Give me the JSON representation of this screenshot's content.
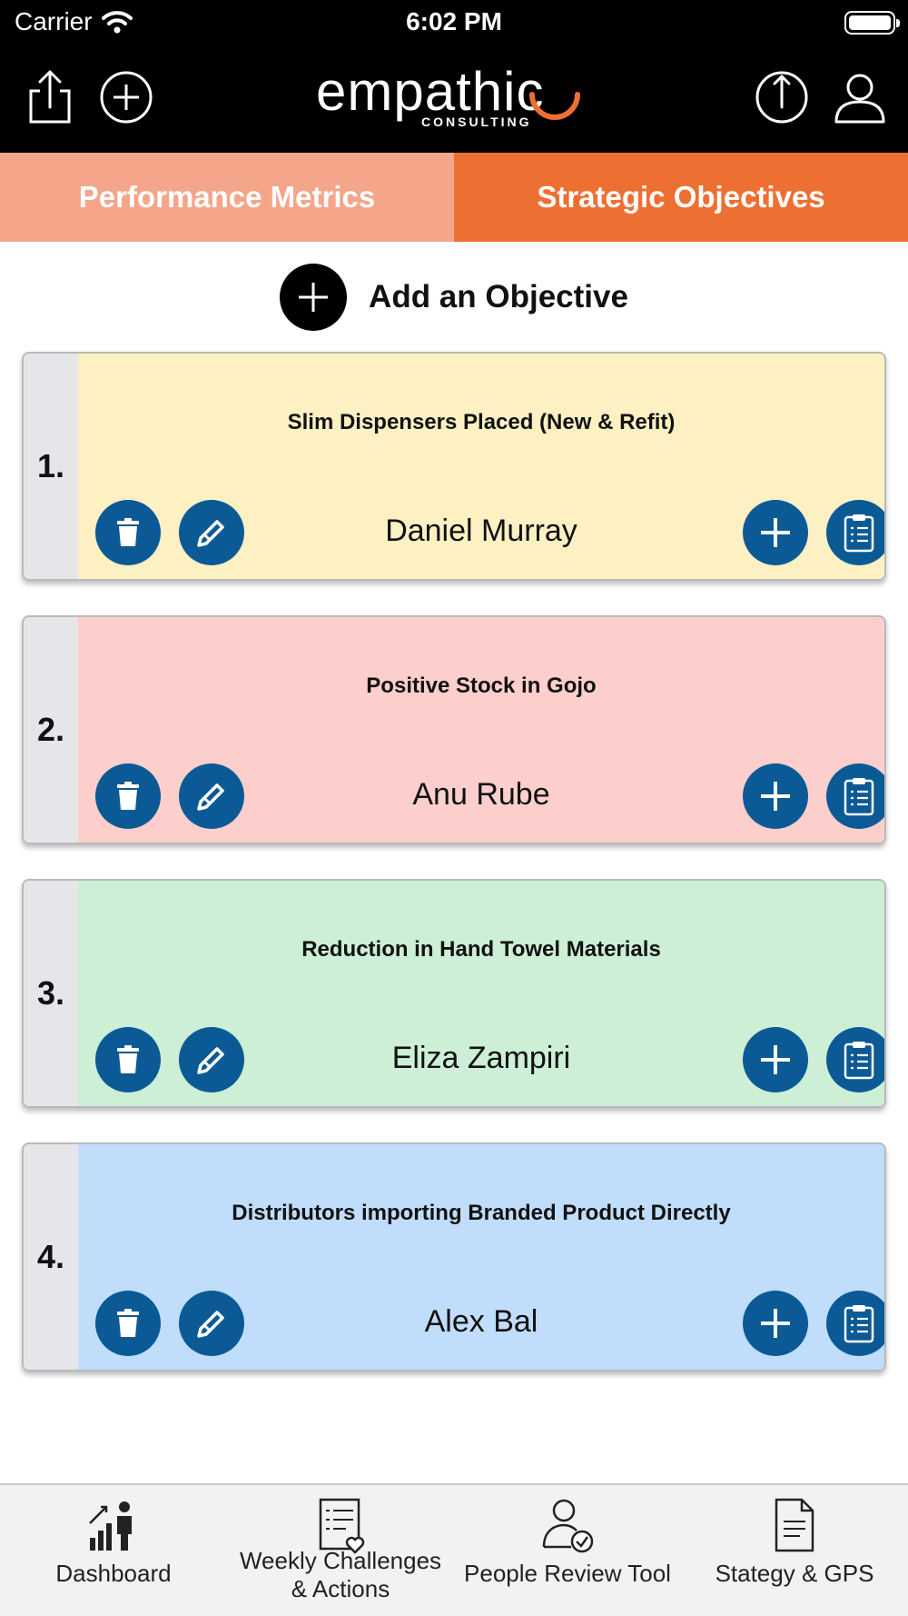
{
  "status_bar": {
    "carrier": "Carrier",
    "time": "6:02 PM"
  },
  "header": {
    "brand": "empathic",
    "brand_sub": "CONSULTING",
    "brand_accent": "#ee6f32",
    "icons": [
      "share-icon",
      "plus-circle-icon",
      "upload-icon",
      "user-icon"
    ]
  },
  "tabs": [
    {
      "label": "Performance Metrics",
      "selected": false
    },
    {
      "label": "Strategic Objectives",
      "selected": true
    }
  ],
  "add_objective_label": "Add an Objective",
  "objectives": [
    {
      "number": "1.",
      "title": "Slim Dispensers Placed (New & Refit)",
      "owner": "Daniel Murray",
      "color": "#fdf0c2"
    },
    {
      "number": "2.",
      "title": "Positive Stock in Gojo",
      "owner": "Anu Rube",
      "color": "#fdcfcc"
    },
    {
      "number": "3.",
      "title": "Reduction in Hand Towel Materials",
      "owner": "Eliza Zampiri",
      "color": "#ccefd5"
    },
    {
      "number": "4.",
      "title": "Distributors importing Branded Product Directly",
      "owner": "Alex Bal",
      "color": "#c0ddfb"
    }
  ],
  "bottom_tabs": [
    {
      "label": "Dashboard",
      "icon": "dashboard-icon"
    },
    {
      "label": "Weekly Challenges & Actions",
      "icon": "checklist-heart-icon"
    },
    {
      "label": "People Review Tool",
      "icon": "person-check-icon"
    },
    {
      "label": "Stategy & GPS",
      "icon": "document-icon"
    }
  ],
  "colors": {
    "button_blue": "#0b5a96",
    "number_column": "#e5e5ea"
  }
}
